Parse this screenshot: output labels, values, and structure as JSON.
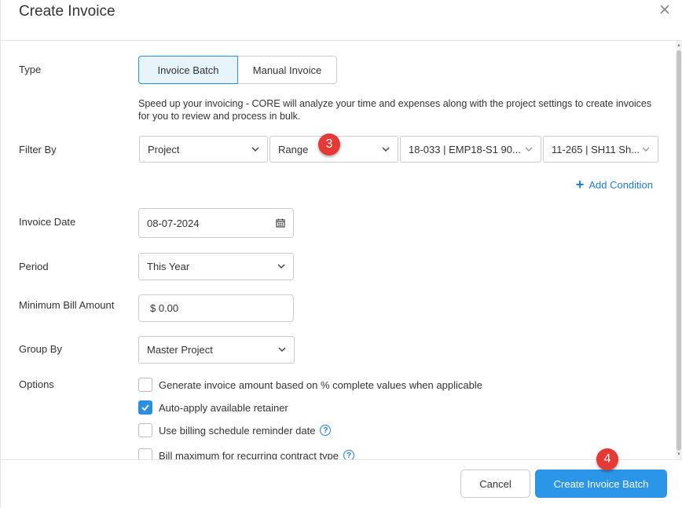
{
  "dialog": {
    "title": "Create Invoice",
    "close_icon": "close-icon"
  },
  "type": {
    "label": "Type",
    "options": [
      "Invoice Batch",
      "Manual Invoice"
    ],
    "selected": "Invoice Batch"
  },
  "help_text": "Speed up your invoicing - CORE will analyze your time and expenses along with the project settings to create invoices for you to review and process in bulk.",
  "filter": {
    "label": "Filter By",
    "field": "Project",
    "operator": "Range",
    "from": "18-033 | EMP18-S1 90...",
    "to": "11-265 | SH11 Sh...",
    "add_condition": "Add Condition"
  },
  "invoice_date": {
    "label": "Invoice Date",
    "value": "08-07-2024",
    "icon": "calendar-icon"
  },
  "period": {
    "label": "Period",
    "value": "This Year"
  },
  "min_bill": {
    "label": "Minimum Bill Amount",
    "value": "$ 0.00"
  },
  "group_by": {
    "label": "Group By",
    "value": "Master Project"
  },
  "options": {
    "label": "Options",
    "items": [
      {
        "label": "Generate invoice amount based on % complete values when applicable",
        "checked": false,
        "help": false
      },
      {
        "label": "Auto-apply available retainer",
        "checked": true,
        "help": false
      },
      {
        "label": "Use billing schedule reminder date",
        "checked": false,
        "help": true
      },
      {
        "label": "Bill maximum for recurring contract type",
        "checked": false,
        "help": true
      }
    ],
    "help_glyph": "?"
  },
  "badges": {
    "step3": "3",
    "step4": "4"
  },
  "footer": {
    "cancel": "Cancel",
    "submit": "Create Invoice Batch"
  },
  "colors": {
    "accent": "#2b96e8",
    "badge": "#e53935",
    "link": "#1f7bd6"
  }
}
